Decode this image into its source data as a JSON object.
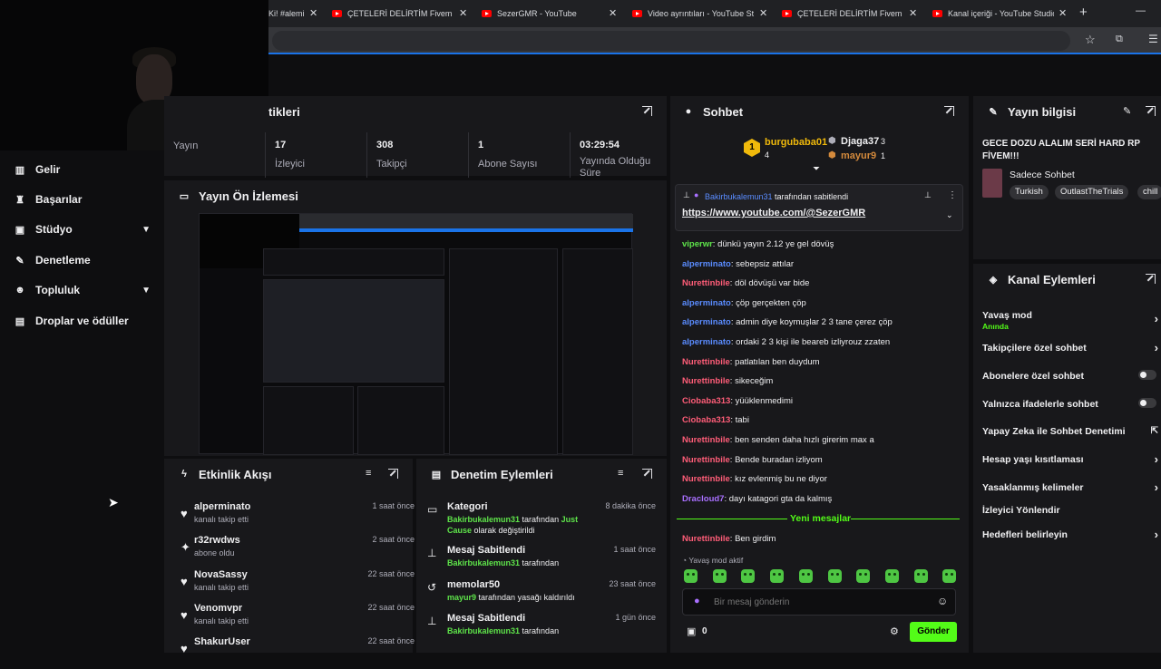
{
  "browser": {
    "tabs": [
      {
        "title": "Ki! #alemi",
        "yt": false
      },
      {
        "title": "ÇETELERİ DELİRTİM Fivem troll...",
        "yt": true
      },
      {
        "title": "SezerGMR - YouTube",
        "yt": true
      },
      {
        "title": "Video ayrıntıları - YouTube Stu...",
        "yt": true
      },
      {
        "title": "ÇETELERİ DELİRTİM Fivem troll...",
        "yt": true
      },
      {
        "title": "Kanal içeriği - YouTube Studio",
        "yt": true
      }
    ],
    "new_tab": "+",
    "window_minimize": "—"
  },
  "sidebar": {
    "items": [
      {
        "label": "Gelir",
        "icon": "bar-chart-icon",
        "chevron": false
      },
      {
        "label": "Başarılar",
        "icon": "trophy-icon",
        "chevron": false
      },
      {
        "label": "Stüdyo",
        "icon": "video-icon",
        "chevron": true
      },
      {
        "label": "Denetleme",
        "icon": "wrench-icon",
        "chevron": false
      },
      {
        "label": "Topluluk",
        "icon": "people-icon",
        "chevron": true
      },
      {
        "label": "Droplar ve ödüller",
        "icon": "gift-icon",
        "chevron": false
      }
    ]
  },
  "stats": {
    "title": "tikleri",
    "items": [
      {
        "value": "",
        "label": "Yayın"
      },
      {
        "value": "17",
        "label": "İzleyici"
      },
      {
        "value": "308",
        "label": "Takipçi"
      },
      {
        "value": "1",
        "label": "Abone Sayısı"
      },
      {
        "value": "03:29:54",
        "label": "Yayında Olduğu Süre"
      }
    ]
  },
  "preview": {
    "title": "Yayın Ön İzlemesi"
  },
  "activity": {
    "title": "Etkinlik Akışı",
    "events": [
      {
        "name": "alperminato",
        "action": "kanalı takip etti",
        "time": "1 saat önce",
        "icon": "heart-icon"
      },
      {
        "name": "r32rwdws",
        "action": "abone oldu",
        "time": "2 saat önce",
        "icon": "sparkle-icon"
      },
      {
        "name": "NovaSassy",
        "action": "kanalı takip etti",
        "time": "22 saat önce",
        "icon": "heart-icon"
      },
      {
        "name": "Venomvpr",
        "action": "kanalı takip etti",
        "time": "22 saat önce",
        "icon": "heart-icon"
      },
      {
        "name": "ShakurUser",
        "action": "",
        "time": "22 saat önce",
        "icon": "heart-icon"
      }
    ]
  },
  "moderation": {
    "title": "Denetim Eylemleri",
    "actions": [
      {
        "title": "Kategori",
        "user": "Bakirbukalemun31",
        "mid": " tarafından ",
        "target": "Just Cause",
        "tail": " olarak değiştirildi",
        "time": "8 dakika önce",
        "icon": "category-icon"
      },
      {
        "title": "Mesaj Sabitlendi",
        "user": "Bakirbukalemun31",
        "mid": " tarafından",
        "target": "",
        "tail": "",
        "time": "1 saat önce",
        "icon": "pin-icon"
      },
      {
        "title": "memolar50",
        "user": "mayur9",
        "mid": " tarafından yasağı kaldırıldı",
        "target": "",
        "tail": "",
        "time": "23 saat önce",
        "icon": "undo-icon"
      },
      {
        "title": "Mesaj Sabitlendi",
        "user": "Bakirbukalemun31",
        "mid": " tarafından",
        "target": "",
        "tail": "",
        "time": "1 gün önce",
        "icon": "pin-icon"
      }
    ]
  },
  "chat": {
    "title": "Sohbet",
    "leaders": [
      {
        "rank": "1",
        "name": "burgubaba01",
        "count": "4"
      },
      {
        "name": "Djaga37",
        "count": "3"
      },
      {
        "name": "mayur9",
        "count": "1"
      }
    ],
    "pinned": {
      "user": "Bakirbukalemun31",
      "suffix": " tarafından sabitlendi",
      "link": "https://www.youtube.com/@SezerGMR"
    },
    "messages": [
      {
        "user": "viperwr",
        "text": "dünkü yayın 2.12 ye gel dövüş",
        "color": "#5ee34a"
      },
      {
        "user": "alperminato",
        "text": "sebepsiz attılar",
        "color": "#5a8cff"
      },
      {
        "user": "Nurettinbile",
        "text": "döl dövüşü var bide",
        "color": "#ff5d78"
      },
      {
        "user": "alperminato",
        "text": "çöp gerçekten çöp",
        "color": "#5a8cff"
      },
      {
        "user": "alperminato",
        "text": "admin diye koymuşlar 2 3 tane çerez çöp",
        "color": "#5a8cff"
      },
      {
        "user": "alperminato",
        "text": "ordaki 2 3 kişi ile beareb izliyrouz zzaten",
        "color": "#5a8cff"
      },
      {
        "user": "Nurettinbile",
        "text": "patlatılan ben duydum",
        "color": "#ff5d78"
      },
      {
        "user": "Nurettinbile",
        "text": "sikeceğim",
        "color": "#ff5d78"
      },
      {
        "user": "Ciobaba313",
        "text": "yüüklenmedimi",
        "color": "#ff5d78"
      },
      {
        "user": "Ciobaba313",
        "text": "tabi",
        "color": "#ff5d78"
      },
      {
        "user": "Nurettinbile",
        "text": "ben senden daha hızlı girerim max a",
        "color": "#ff5d78"
      },
      {
        "user": "Nurettinbile",
        "text": "Bende buradan izliyom",
        "color": "#ff5d78"
      },
      {
        "user": "Nurettinbile",
        "text": "kız evlenmiş bu ne diyor",
        "color": "#ff5d78"
      },
      {
        "user": "Dracloud7",
        "text": "dayı katagori gta da kalmış",
        "color": "#a970ff"
      }
    ],
    "new_messages": "Yeni mesajlar",
    "after": {
      "user": "Nurettinbile",
      "text": "Ben girdim",
      "color": "#ff5d78"
    },
    "slow_mode": "Yavaş mod aktif",
    "input_placeholder": "Bir mesaj gönderin",
    "points": "0",
    "send": "Gönder"
  },
  "stream_info": {
    "title": "Yayın bilgisi",
    "stream_title": "GECE DOZU ALALIM SERİ HARD RP FİVEM!!!",
    "category": "Sadece Sohbet",
    "tags": [
      "Turkish",
      "OutlastTheTrials",
      "chill"
    ]
  },
  "channel_actions": {
    "title": "Kanal Eylemleri",
    "options": [
      {
        "label": "Yavaş mod",
        "sub": "Anında",
        "control": "arrow"
      },
      {
        "label": "Takipçilere özel sohbet",
        "sub": "",
        "control": "arrow"
      },
      {
        "label": "Abonelere özel sohbet",
        "sub": "",
        "control": "toggle"
      },
      {
        "label": "Yalnızca ifadelerle sohbet",
        "sub": "",
        "control": "toggle"
      },
      {
        "label": "Yapay Zeka ile Sohbet Denetimi",
        "sub": "",
        "control": "popout"
      },
      {
        "label": "Hesap yaşı kısıtlaması",
        "sub": "",
        "control": "arrow"
      },
      {
        "label": "Yasaklanmış kelimeler",
        "sub": "",
        "control": "arrow"
      },
      {
        "label": "İzleyici Yönlendir",
        "sub": "",
        "control": "none"
      },
      {
        "label": "Hedefleri belirleyin",
        "sub": "",
        "control": "arrow"
      }
    ]
  },
  "colors": {
    "accent": "#53fc18",
    "bg": "#0e0e10",
    "panel": "#18181b"
  }
}
